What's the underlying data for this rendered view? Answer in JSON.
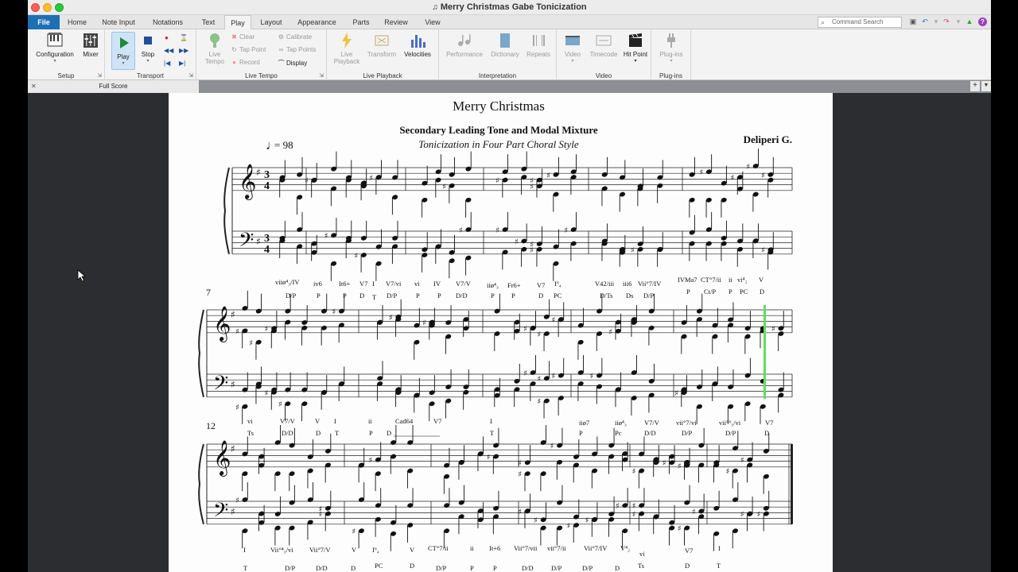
{
  "window": {
    "title": "Merry Christmas Gabe Tonicization"
  },
  "tabs": [
    {
      "label": "File",
      "state": "file"
    },
    {
      "label": "Home",
      "state": ""
    },
    {
      "label": "Note Input",
      "state": ""
    },
    {
      "label": "Notations",
      "state": ""
    },
    {
      "label": "Text",
      "state": ""
    },
    {
      "label": "Play",
      "state": "active"
    },
    {
      "label": "Layout",
      "state": ""
    },
    {
      "label": "Appearance",
      "state": ""
    },
    {
      "label": "Parts",
      "state": ""
    },
    {
      "label": "Review",
      "state": ""
    },
    {
      "label": "View",
      "state": ""
    }
  ],
  "search": {
    "placeholder": "Command Search"
  },
  "ribbon": {
    "setup": {
      "label": "Setup",
      "configuration": "Configuration",
      "mixer": "Mixer"
    },
    "transport": {
      "label": "Transport",
      "play": "Play",
      "stop": "Stop"
    },
    "live_tempo": {
      "label": "Live Tempo",
      "live_tempo_btn": "Live Tempo",
      "clear": "Clear",
      "tap_point": "Tap Point",
      "record": "Record",
      "calibrate": "Calibrate",
      "tap_points": "Tap Points",
      "display": "Display"
    },
    "live_playback": {
      "label": "Live Playback",
      "live_playback_btn": "Live Playback",
      "transform": "Transform",
      "velocities": "Velocities"
    },
    "interpretation": {
      "label": "Interpretation",
      "performance": "Performance",
      "dictionary": "Dictionary",
      "repeats": "Repeats"
    },
    "video": {
      "label": "Video",
      "video_btn": "Video",
      "timecode": "Timecode",
      "hit_point": "Hit Point"
    },
    "plugins": {
      "label": "Plug-ins",
      "plugins_btn": "Plug-ins"
    }
  },
  "document": {
    "tab_label": "Full Score"
  },
  "score": {
    "title": "Merry Christmas",
    "subtitle": "Secondary Leading Tone and Modal Mixture",
    "subtitle2": "Tonicization in Four Part Choral Style",
    "composer": "Deliperi G.",
    "tempo": "= 98",
    "system2_number": "7",
    "system3_number": "12",
    "analysis_row1": [
      "viiø⁴₃/IV",
      "iv6",
      "It6+",
      "V7",
      "I",
      "V7/vi",
      "vi",
      "IV",
      "V7/V",
      "iiø⁴₃",
      "Fr6+",
      "V7",
      "I⁶₄",
      "V42/iii",
      "iii6",
      "Vii°7/IV",
      "IVMa7",
      "CT°7/ii",
      "ii",
      "vi⁴₂",
      "V"
    ],
    "function_row1": [
      "D/P",
      "P",
      "P",
      "D",
      "T",
      "D/P",
      "P",
      "P",
      "D/D",
      "P",
      "P",
      "D",
      "PC",
      "D/Ts",
      "Ds",
      "D/P",
      "P",
      "Ct/P",
      "P",
      "PC",
      "D"
    ],
    "analysis_row2": [
      "vi",
      "V7/V",
      "V",
      "I",
      "ii",
      "Cad64",
      "V7",
      "I",
      "iiø7",
      "iiø⁴₃",
      "V7/V",
      "vii°7/vi",
      "vii°⁶₅/vi",
      "V7"
    ],
    "function_row2": [
      "Ts",
      "D/D",
      "D",
      "T",
      "P",
      "D",
      "T",
      "P",
      "Pc",
      "D/D",
      "D/P",
      "D/P",
      "D"
    ],
    "analysis_row3": [
      "I",
      "Vii°⁴₃/vi",
      "Vii°7/V",
      "V",
      "I⁶₄",
      "V",
      "CT°7/ii",
      "ii",
      "It+6",
      "Vii°7/vii",
      "vii°7/ii",
      "Vii°7/IV",
      "V⁴₂",
      "vi",
      "V7",
      "I"
    ],
    "function_row3": [
      "T",
      "D/P",
      "D/D",
      "D",
      "PC",
      "D",
      "D/P",
      "P",
      "P",
      "D/D",
      "D/P",
      "D/P",
      "D",
      "Ts",
      "D",
      "T"
    ]
  },
  "colors": {
    "file_tab": "#1f6fb5",
    "playback_cursor": "#5de05d",
    "workspace": "#2b2d30"
  }
}
